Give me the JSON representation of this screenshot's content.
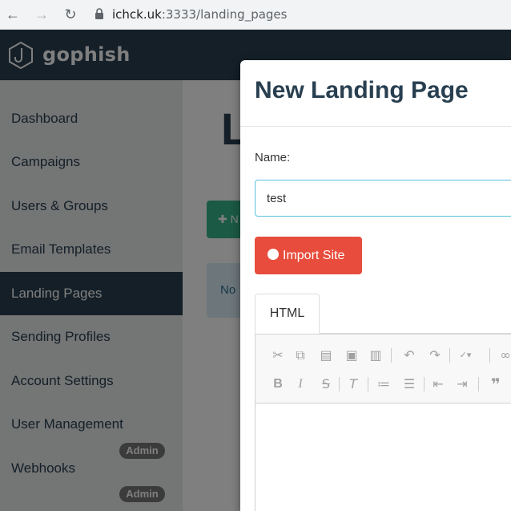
{
  "browser": {
    "url_host": "ichck.uk",
    "url_rest": ":3333/landing_pages"
  },
  "brand": {
    "name": "gophish"
  },
  "sidebar": {
    "items": [
      {
        "label": "Dashboard"
      },
      {
        "label": "Campaigns"
      },
      {
        "label": "Users & Groups"
      },
      {
        "label": "Email Templates"
      },
      {
        "label": "Landing Pages",
        "active": true
      },
      {
        "label": "Sending Profiles"
      },
      {
        "label": "Account Settings"
      },
      {
        "label": "User Management"
      },
      {
        "label": "Webhooks"
      }
    ],
    "admin_badge": "Admin"
  },
  "main": {
    "title_partial": "L",
    "new_button_partial": "N",
    "no_pages_partial": "No"
  },
  "modal": {
    "title": "New Landing Page",
    "name_label": "Name:",
    "name_value": "test",
    "import_button": "Import Site",
    "tab_html": "HTML"
  },
  "colors": {
    "navbar": "#283f50",
    "import_button": "#e74c3c",
    "new_button": "#37b48b",
    "input_focus": "#5bc0de"
  },
  "icons": {
    "toolbar_row1": [
      "cut-icon",
      "copy-icon",
      "paste-icon",
      "paste-text-icon",
      "paste-word-icon",
      "undo-icon",
      "redo-icon",
      "spellcheck-icon",
      "link-icon"
    ],
    "toolbar_row2": [
      "bold-icon",
      "italic-icon",
      "strikethrough-icon",
      "remove-format-icon",
      "numbered-list-icon",
      "bulleted-list-icon",
      "outdent-icon",
      "indent-icon",
      "blockquote-icon"
    ]
  }
}
